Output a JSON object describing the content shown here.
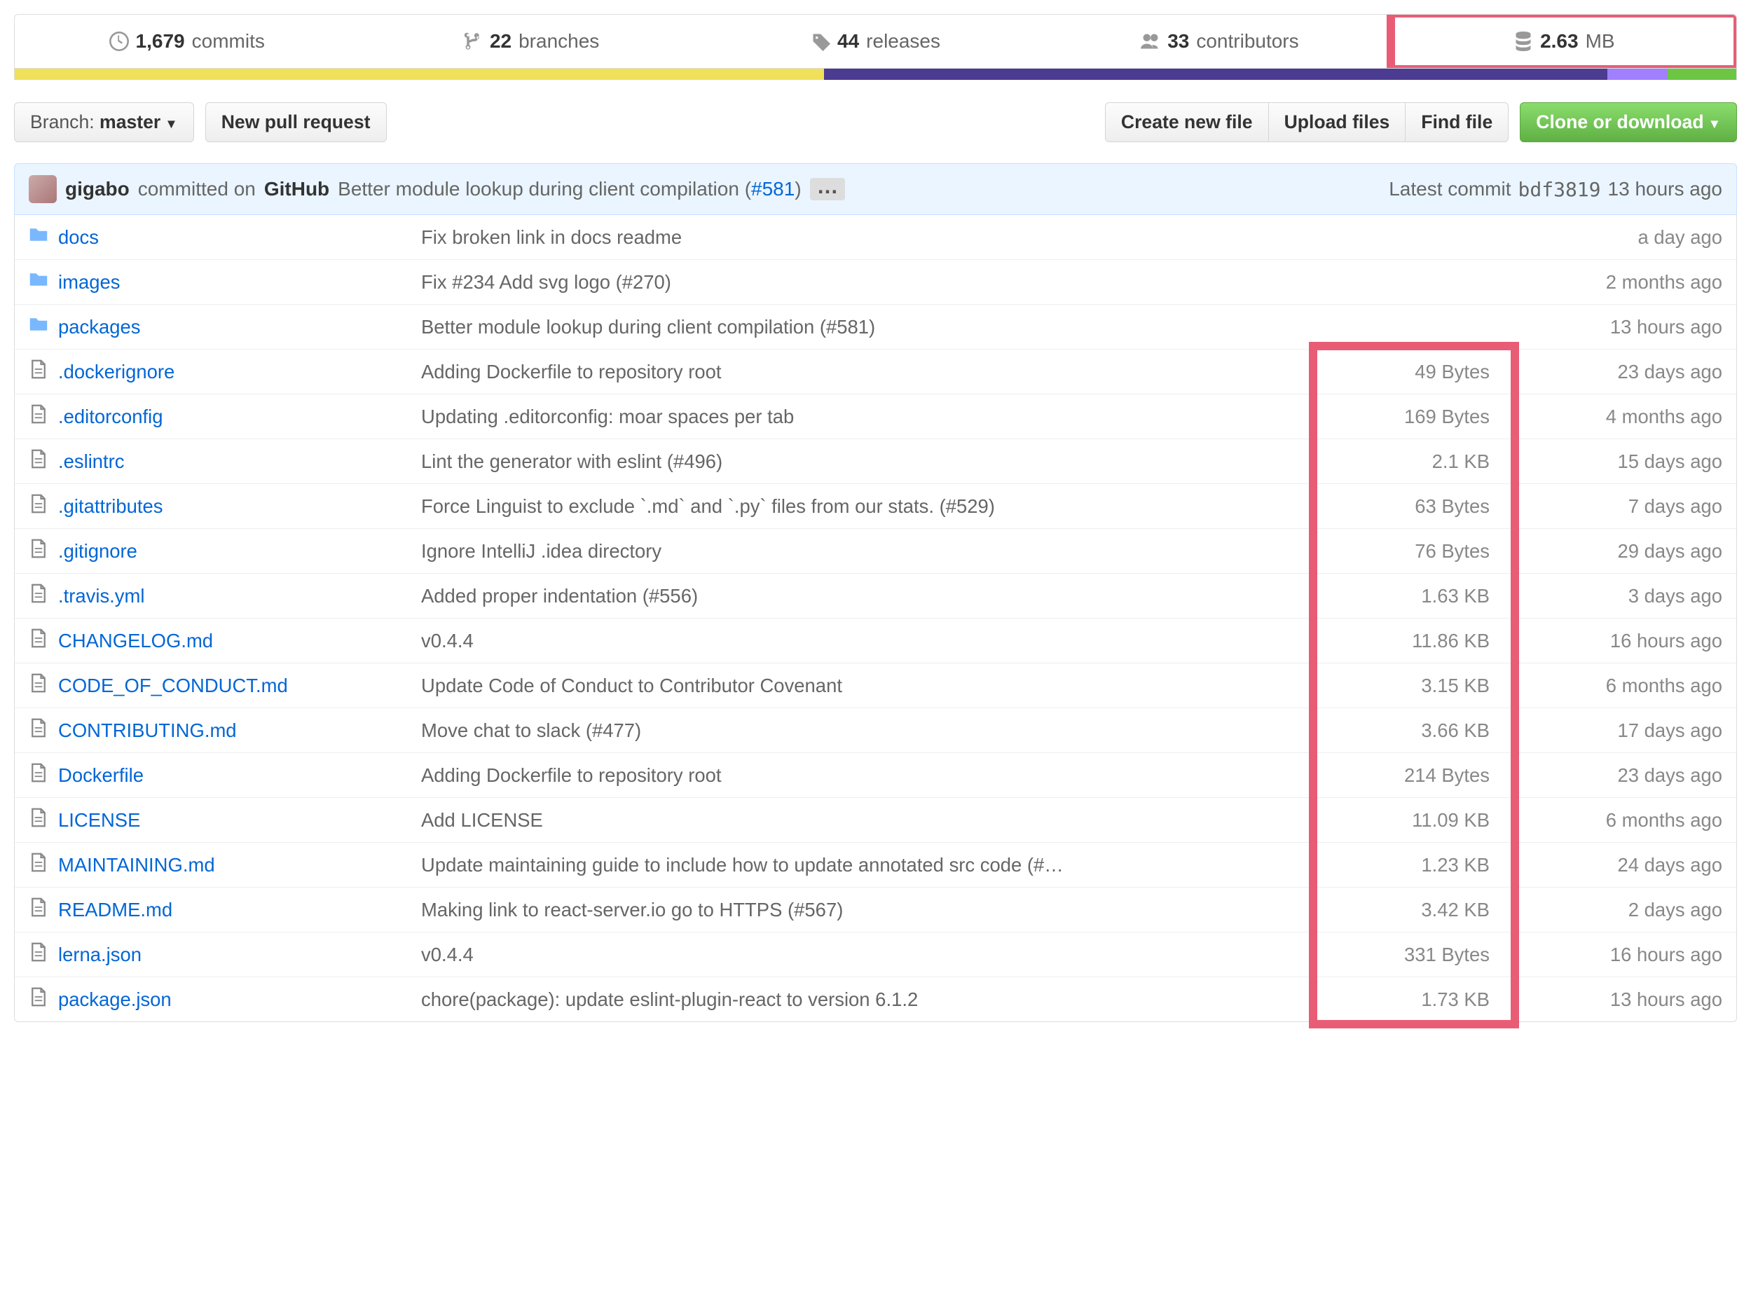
{
  "stats": {
    "commits": {
      "count": "1,679",
      "label": "commits"
    },
    "branches": {
      "count": "22",
      "label": "branches"
    },
    "releases": {
      "count": "44",
      "label": "releases"
    },
    "contributors": {
      "count": "33",
      "label": "contributors"
    },
    "size": {
      "value": "2.63",
      "unit": "MB"
    }
  },
  "lang_bar": [
    {
      "color": "lang-yellow",
      "pct": 47.0
    },
    {
      "color": "lang-purple",
      "pct": 45.5
    },
    {
      "color": "lang-lpurple",
      "pct": 3.5
    },
    {
      "color": "lang-green",
      "pct": 4.0
    }
  ],
  "buttons": {
    "branch_prefix": "Branch: ",
    "branch_name": "master",
    "new_pr": "New pull request",
    "create_file": "Create new file",
    "upload_files": "Upload files",
    "find_file": "Find file",
    "clone": "Clone or download"
  },
  "commit": {
    "author": "gigabo",
    "committed_text": "committed on",
    "on_github": "GitHub",
    "message": "Better module lookup during client compilation (",
    "pr": "#581",
    "message_suffix": ")",
    "latest_label": "Latest commit",
    "sha": "bdf3819",
    "when": "13 hours ago"
  },
  "files": [
    {
      "kind": "dir",
      "name": "docs",
      "msg": "Fix broken link in docs readme",
      "size": "",
      "when": "a day ago"
    },
    {
      "kind": "dir",
      "name": "images",
      "msg": "Fix #234 Add svg logo (#270)",
      "size": "",
      "when": "2 months ago"
    },
    {
      "kind": "dir",
      "name": "packages",
      "msg": "Better module lookup during client compilation (#581)",
      "size": "",
      "when": "13 hours ago"
    },
    {
      "kind": "file",
      "name": ".dockerignore",
      "msg": "Adding Dockerfile to repository root",
      "size": "49 Bytes",
      "when": "23 days ago"
    },
    {
      "kind": "file",
      "name": ".editorconfig",
      "msg": "Updating .editorconfig: moar spaces per tab",
      "size": "169 Bytes",
      "when": "4 months ago"
    },
    {
      "kind": "file",
      "name": ".eslintrc",
      "msg": "Lint the generator with eslint (#496)",
      "size": "2.1 KB",
      "when": "15 days ago"
    },
    {
      "kind": "file",
      "name": ".gitattributes",
      "msg": "Force Linguist to exclude `.md` and `.py` files from our stats. (#529)",
      "size": "63 Bytes",
      "when": "7 days ago"
    },
    {
      "kind": "file",
      "name": ".gitignore",
      "msg": "Ignore IntelliJ .idea directory",
      "size": "76 Bytes",
      "when": "29 days ago"
    },
    {
      "kind": "file",
      "name": ".travis.yml",
      "msg": "Added proper indentation (#556)",
      "size": "1.63 KB",
      "when": "3 days ago"
    },
    {
      "kind": "file",
      "name": "CHANGELOG.md",
      "msg": "v0.4.4",
      "size": "11.86 KB",
      "when": "16 hours ago"
    },
    {
      "kind": "file",
      "name": "CODE_OF_CONDUCT.md",
      "msg": "Update Code of Conduct to Contributor Covenant",
      "size": "3.15 KB",
      "when": "6 months ago"
    },
    {
      "kind": "file",
      "name": "CONTRIBUTING.md",
      "msg": "Move chat to slack (#477)",
      "size": "3.66 KB",
      "when": "17 days ago"
    },
    {
      "kind": "file",
      "name": "Dockerfile",
      "msg": "Adding Dockerfile to repository root",
      "size": "214 Bytes",
      "when": "23 days ago"
    },
    {
      "kind": "file",
      "name": "LICENSE",
      "msg": "Add LICENSE",
      "size": "11.09 KB",
      "when": "6 months ago"
    },
    {
      "kind": "file",
      "name": "MAINTAINING.md",
      "msg": "Update maintaining guide to include how to update annotated src code (#…",
      "size": "1.23 KB",
      "when": "24 days ago"
    },
    {
      "kind": "file",
      "name": "README.md",
      "msg": "Making link to react-server.io go to HTTPS (#567)",
      "size": "3.42 KB",
      "when": "2 days ago"
    },
    {
      "kind": "file",
      "name": "lerna.json",
      "msg": "v0.4.4",
      "size": "331 Bytes",
      "when": "16 hours ago"
    },
    {
      "kind": "file",
      "name": "package.json",
      "msg": "chore(package): update eslint-plugin-react to version 6.1.2",
      "size": "1.73 KB",
      "when": "13 hours ago"
    }
  ]
}
